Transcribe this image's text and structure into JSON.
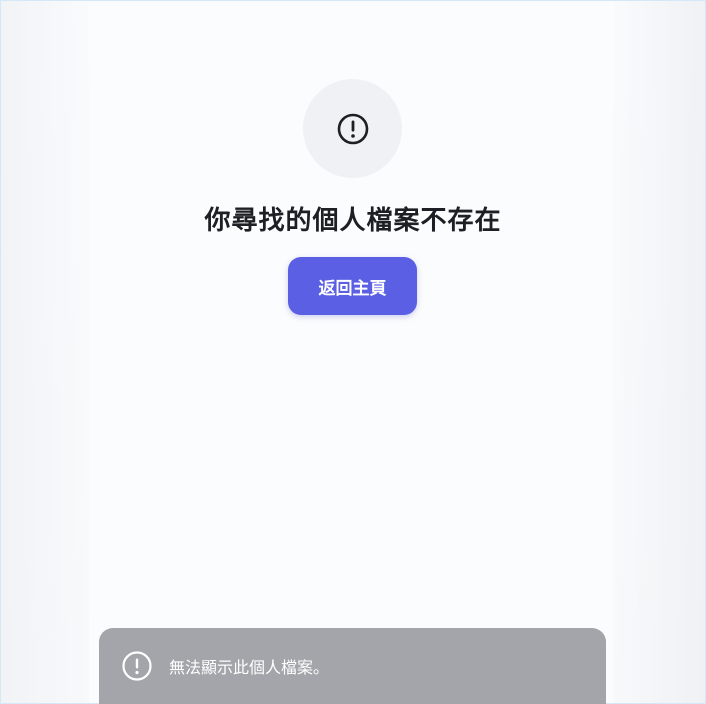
{
  "error": {
    "title": "你尋找的個人檔案不存在",
    "icon": "exclamation-circle-icon"
  },
  "actions": {
    "home_label": "返回主頁"
  },
  "toast": {
    "message": "無法顯示此個人檔案。",
    "icon": "exclamation-circle-icon"
  },
  "colors": {
    "button": "#5a5fe4",
    "toast_bg": "#a3a5aa",
    "title": "#1d1f24"
  }
}
